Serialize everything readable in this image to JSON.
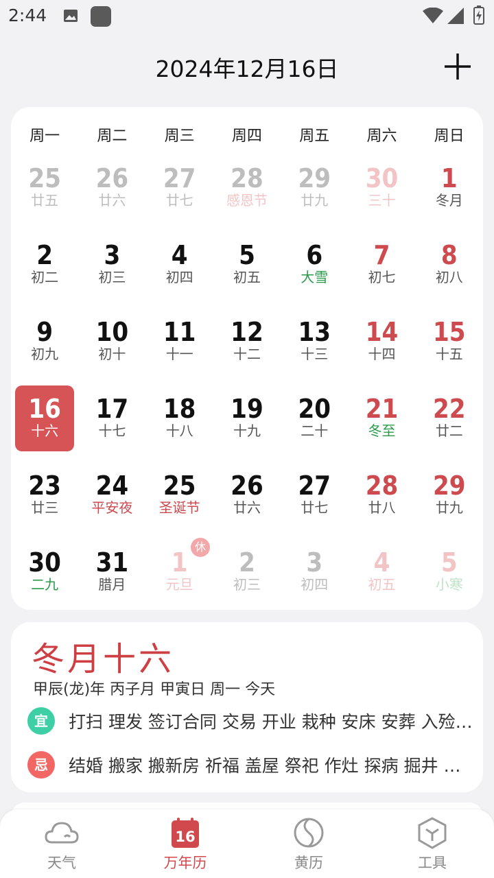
{
  "status_bar": {
    "time": "2:44"
  },
  "header": {
    "title": "2024年12月16日"
  },
  "weekdays": [
    "周一",
    "周二",
    "周三",
    "周四",
    "周五",
    "周六",
    "周日"
  ],
  "days": [
    [
      {
        "n": "25",
        "l": "廿五",
        "c": "gray"
      },
      {
        "n": "26",
        "l": "廿六",
        "c": "gray"
      },
      {
        "n": "27",
        "l": "廿七",
        "c": "gray"
      },
      {
        "n": "28",
        "l": "感恩节",
        "c": "gray",
        "lc": "pink"
      },
      {
        "n": "29",
        "l": "廿九",
        "c": "gray"
      },
      {
        "n": "30",
        "l": "三十",
        "c": "pink",
        "lc": "gray"
      },
      {
        "n": "1",
        "l": "冬月",
        "c": "red",
        "lc": "dark"
      }
    ],
    [
      {
        "n": "2",
        "l": "初二",
        "c": "dark"
      },
      {
        "n": "3",
        "l": "初三",
        "c": "dark"
      },
      {
        "n": "4",
        "l": "初四",
        "c": "dark"
      },
      {
        "n": "5",
        "l": "初五",
        "c": "dark"
      },
      {
        "n": "6",
        "l": "大雪",
        "c": "dark",
        "lc": "green"
      },
      {
        "n": "7",
        "l": "初七",
        "c": "red"
      },
      {
        "n": "8",
        "l": "初八",
        "c": "red"
      }
    ],
    [
      {
        "n": "9",
        "l": "初九",
        "c": "dark"
      },
      {
        "n": "10",
        "l": "初十",
        "c": "dark"
      },
      {
        "n": "11",
        "l": "十一",
        "c": "dark"
      },
      {
        "n": "12",
        "l": "十二",
        "c": "dark"
      },
      {
        "n": "13",
        "l": "十三",
        "c": "dark"
      },
      {
        "n": "14",
        "l": "十四",
        "c": "red"
      },
      {
        "n": "15",
        "l": "十五",
        "c": "red"
      }
    ],
    [
      {
        "n": "16",
        "l": "十六",
        "c": "dark",
        "selected": true
      },
      {
        "n": "17",
        "l": "十七",
        "c": "dark"
      },
      {
        "n": "18",
        "l": "十八",
        "c": "dark"
      },
      {
        "n": "19",
        "l": "十九",
        "c": "dark"
      },
      {
        "n": "20",
        "l": "二十",
        "c": "dark"
      },
      {
        "n": "21",
        "l": "冬至",
        "c": "red",
        "lc": "green"
      },
      {
        "n": "22",
        "l": "廿二",
        "c": "red"
      }
    ],
    [
      {
        "n": "23",
        "l": "廿三",
        "c": "dark"
      },
      {
        "n": "24",
        "l": "平安夜",
        "c": "dark",
        "lc": "red"
      },
      {
        "n": "25",
        "l": "圣诞节",
        "c": "dark",
        "lc": "red"
      },
      {
        "n": "26",
        "l": "廿六",
        "c": "dark"
      },
      {
        "n": "27",
        "l": "廿七",
        "c": "dark"
      },
      {
        "n": "28",
        "l": "廿八",
        "c": "red"
      },
      {
        "n": "29",
        "l": "廿九",
        "c": "red"
      }
    ],
    [
      {
        "n": "30",
        "l": "二九",
        "c": "dark",
        "lc": "green"
      },
      {
        "n": "31",
        "l": "腊月",
        "c": "dark"
      },
      {
        "n": "1",
        "l": "元旦",
        "c": "pink",
        "lc": "pink"
      },
      {
        "n": "2",
        "l": "初三",
        "c": "gray"
      },
      {
        "n": "3",
        "l": "初四",
        "c": "gray"
      },
      {
        "n": "4",
        "l": "初五",
        "c": "pink",
        "lc": "gray"
      },
      {
        "n": "5",
        "l": "小寒",
        "c": "pink",
        "lc": "lgreen"
      }
    ]
  ],
  "rest_badge": "休",
  "info": {
    "lunar_date": "冬月十六",
    "ganzhi": "甲辰(龙)年 丙子月 甲寅日 周一 今天",
    "yi_label": "宜",
    "yi_text": "打扫 理发 签订合同 交易 开业 栽种 安床 安葬 入殓 移柩",
    "ji_label": "忌",
    "ji_text": "结婚 搬家 搬新房 祈福 盖屋 祭祀 作灶 探病 掘井 出行"
  },
  "tabs": [
    {
      "label": "天气",
      "icon": "cloud-icon"
    },
    {
      "label": "万年历",
      "icon": "calendar-icon",
      "badge": "16",
      "active": true
    },
    {
      "label": "黄历",
      "icon": "yinyang-icon"
    },
    {
      "label": "工具",
      "icon": "cube-icon"
    }
  ],
  "colors": {
    "accent": "#d65456",
    "red": "#cd4a4f",
    "green": "#2a9a4a",
    "yi": "#3fcfa6",
    "ji": "#f26763"
  }
}
